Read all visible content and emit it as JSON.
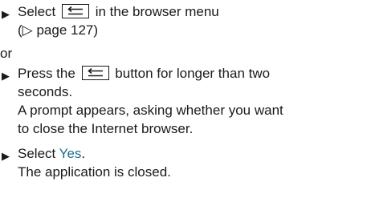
{
  "step1": {
    "bullet": "▶",
    "text_before": "Select",
    "button_icon": "back-arrow-icon",
    "text_after": "in the browser menu",
    "ref": "(▷ page 127)"
  },
  "or_label": "or",
  "step2": {
    "bullet": "▶",
    "text_before": "Press the",
    "button_icon": "back-arrow-icon",
    "text_after": "button for longer than two",
    "line2": "seconds.",
    "result_line1": "A prompt appears, asking whether you want",
    "result_line2": "to close the Internet browser."
  },
  "step3": {
    "bullet": "▶",
    "text_before": "Select",
    "option": "Yes",
    "text_after": ".",
    "result": "The application is closed."
  },
  "colors": {
    "text": "#1a1a1a",
    "accent": "#1f6f8b"
  }
}
